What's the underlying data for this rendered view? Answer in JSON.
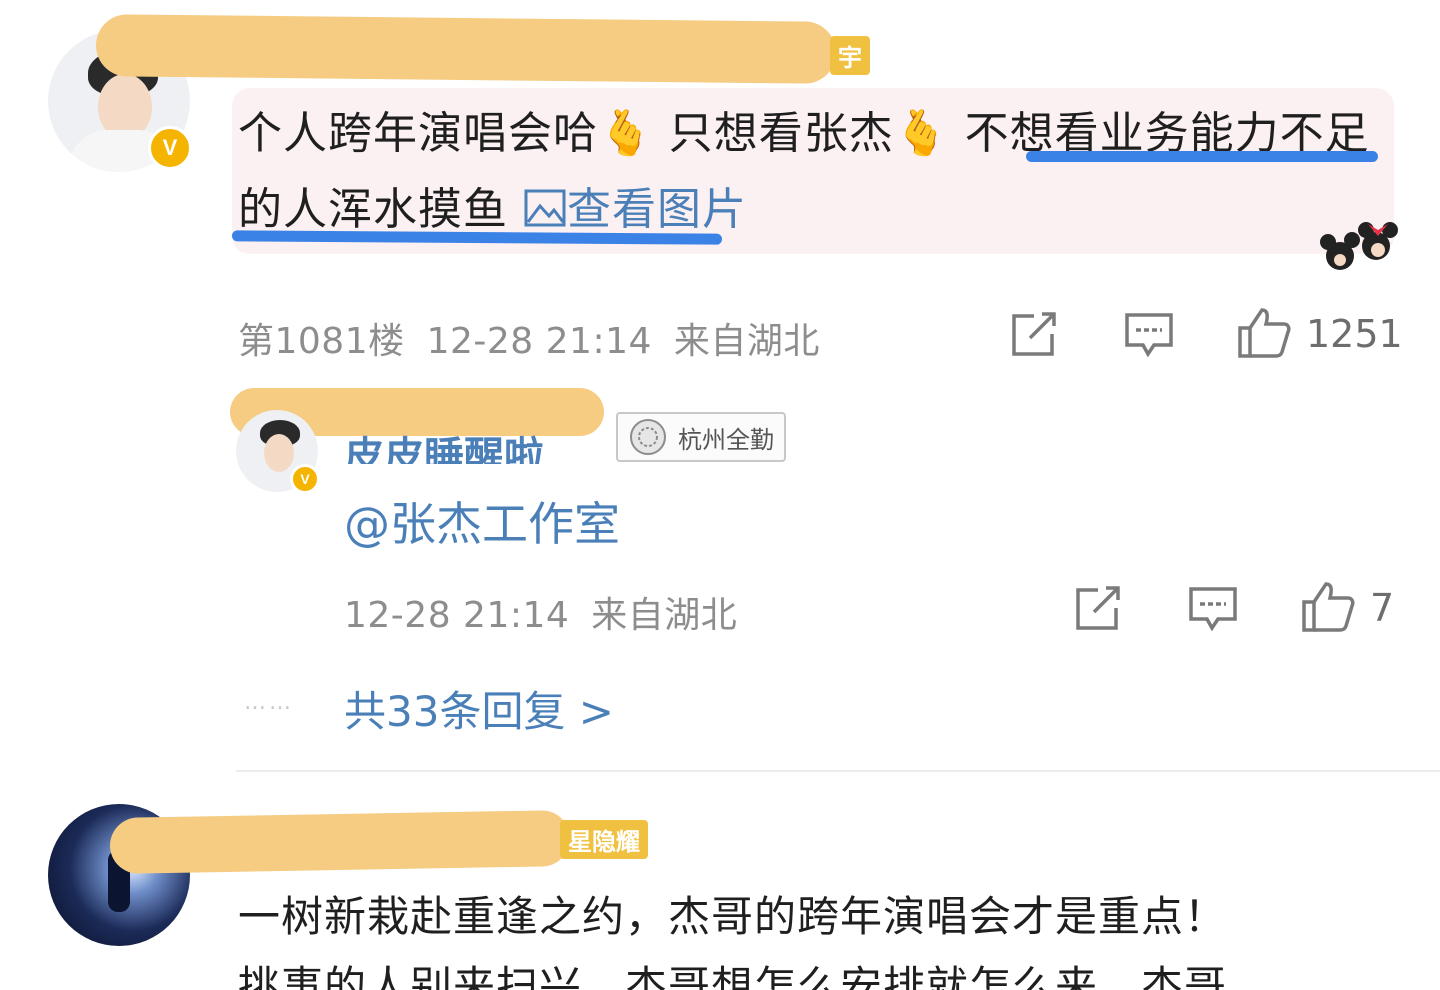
{
  "comment1": {
    "name_tag": "宇",
    "verified_mark": "V",
    "text_part1": "个人跨年演唱会哈",
    "text_part2": "只想看张杰",
    "text_part3": "不想看业务能力不足的人浑水摸鱼",
    "heart_emoji": "🫰",
    "view_image_label": "查看图片",
    "floor": "第1081楼",
    "time": "12-28 21:14",
    "location": "来自湖北",
    "like_count": "1251",
    "icons": [
      "share-icon",
      "comment-icon",
      "like-icon",
      "image-icon",
      "minnie-mouse-sticker"
    ]
  },
  "reply": {
    "name": "皮皮睡醒啦_",
    "verified_mark": "V",
    "badge_label": "杭州全勤",
    "text": "@张杰工作室",
    "time": "12-28 21:14",
    "location": "来自湖北",
    "like_count": "7",
    "more_dots": "……",
    "more_replies": "共33条回复 >"
  },
  "comment2": {
    "name_tag": "星隐耀",
    "text_line1": "一树新栽赴重逢之约，杰哥的跨年演唱会才是重点！",
    "text_line2": "挑事的人别来扫兴，杰哥想怎么安排就怎么来，杰哥"
  },
  "colors": {
    "link_blue": "#4a7fb8",
    "underline_blue": "#3a82e6",
    "redaction": "#f5cc82",
    "bubble_pink": "#fbf0f2",
    "verified_gold": "#f5b400"
  }
}
